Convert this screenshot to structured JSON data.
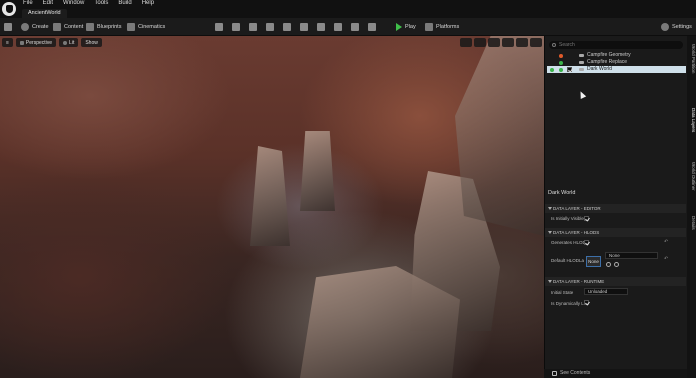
{
  "menu": {
    "items": [
      "File",
      "Edit",
      "Window",
      "Tools",
      "Build",
      "Help"
    ],
    "level_tab": "AncientWorld"
  },
  "toolbar": {
    "create": "Create",
    "content": "Content",
    "blueprints": "Blueprints",
    "cinematics": "Cinematics",
    "play": "Play",
    "platforms": "Platforms",
    "settings": "Settings"
  },
  "viewport": {
    "menu": "≡",
    "perspective": "Perspective",
    "lit": "Lit",
    "show": "Show"
  },
  "data_layers_panel": {
    "search_placeholder": "Search",
    "layers": [
      {
        "name": "Campfire Geometry",
        "color": "#e05a2a",
        "selected": false
      },
      {
        "name": "Campfire Replace",
        "color": "#3bb34a",
        "selected": false
      },
      {
        "name": "Dark World",
        "color": "#3bb34a",
        "selected": true
      }
    ]
  },
  "side_tabs": [
    "World Partition",
    "Data Layers",
    "World Outliner",
    "Details"
  ],
  "details": {
    "title": "Dark World",
    "sections": {
      "editor": "DATA LAYER - EDITOR",
      "hlods": "DATA LAYER - HLODS",
      "runtime": "DATA LAYER - RUNTIME"
    },
    "props": {
      "initially_visible": "Is Initially Visible",
      "generates_hlod": "Generates HLOD",
      "default_hlod": "Default HLODLa",
      "none_tag": "None",
      "none_dropdown": "None",
      "initial_state": "Initial State",
      "initial_state_value": "Unloaded",
      "is_dynamically": "Is Dynamically L"
    }
  },
  "bottom_bar": {
    "see_contents": "See Contents"
  },
  "colors": {
    "accent_green": "#3bb34a",
    "selection": "#cfe0ea",
    "panel_bg": "#1a1a1a"
  }
}
